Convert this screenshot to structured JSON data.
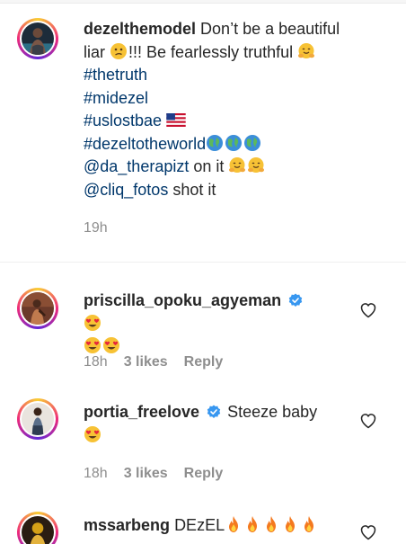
{
  "caption": {
    "username": "dezelthemodel",
    "text_part1": "Don’t be a beautiful",
    "text_part2": "liar",
    "text_part3": "!!! Be fearlessly truthful",
    "hashtags": [
      "#thetruth",
      "#midezel",
      "#uslostbae",
      "#dezeltotheworld"
    ],
    "mention1": "@da_therapizt",
    "mention1_suffix": "on it",
    "mention2": "@cliq_fotos",
    "mention2_suffix": "shot it",
    "time": "19h"
  },
  "comments": [
    {
      "username": "priscilla_opoku_agyeman",
      "verified": true,
      "text": "",
      "emoji": [
        "heart-eyes-emoji",
        "heart-eyes-emoji",
        "heart-eyes-emoji"
      ],
      "time": "18h",
      "likes": "3 likes",
      "reply": "Reply"
    },
    {
      "username": "portia_freelove",
      "verified": true,
      "text": "Steeze baby",
      "emoji": [
        "heart-eyes-emoji"
      ],
      "time": "18h",
      "likes": "3 likes",
      "reply": "Reply"
    },
    {
      "username": "mssarbeng",
      "verified": false,
      "text": "DEzEL",
      "emoji": [
        "fire-emoji",
        "fire-emoji",
        "fire-emoji",
        "fire-emoji",
        "fire-emoji"
      ]
    }
  ],
  "colors": {
    "link": "#00376b",
    "meta": "#8e8e8e",
    "verified": "#3897f0",
    "text": "#262626"
  }
}
